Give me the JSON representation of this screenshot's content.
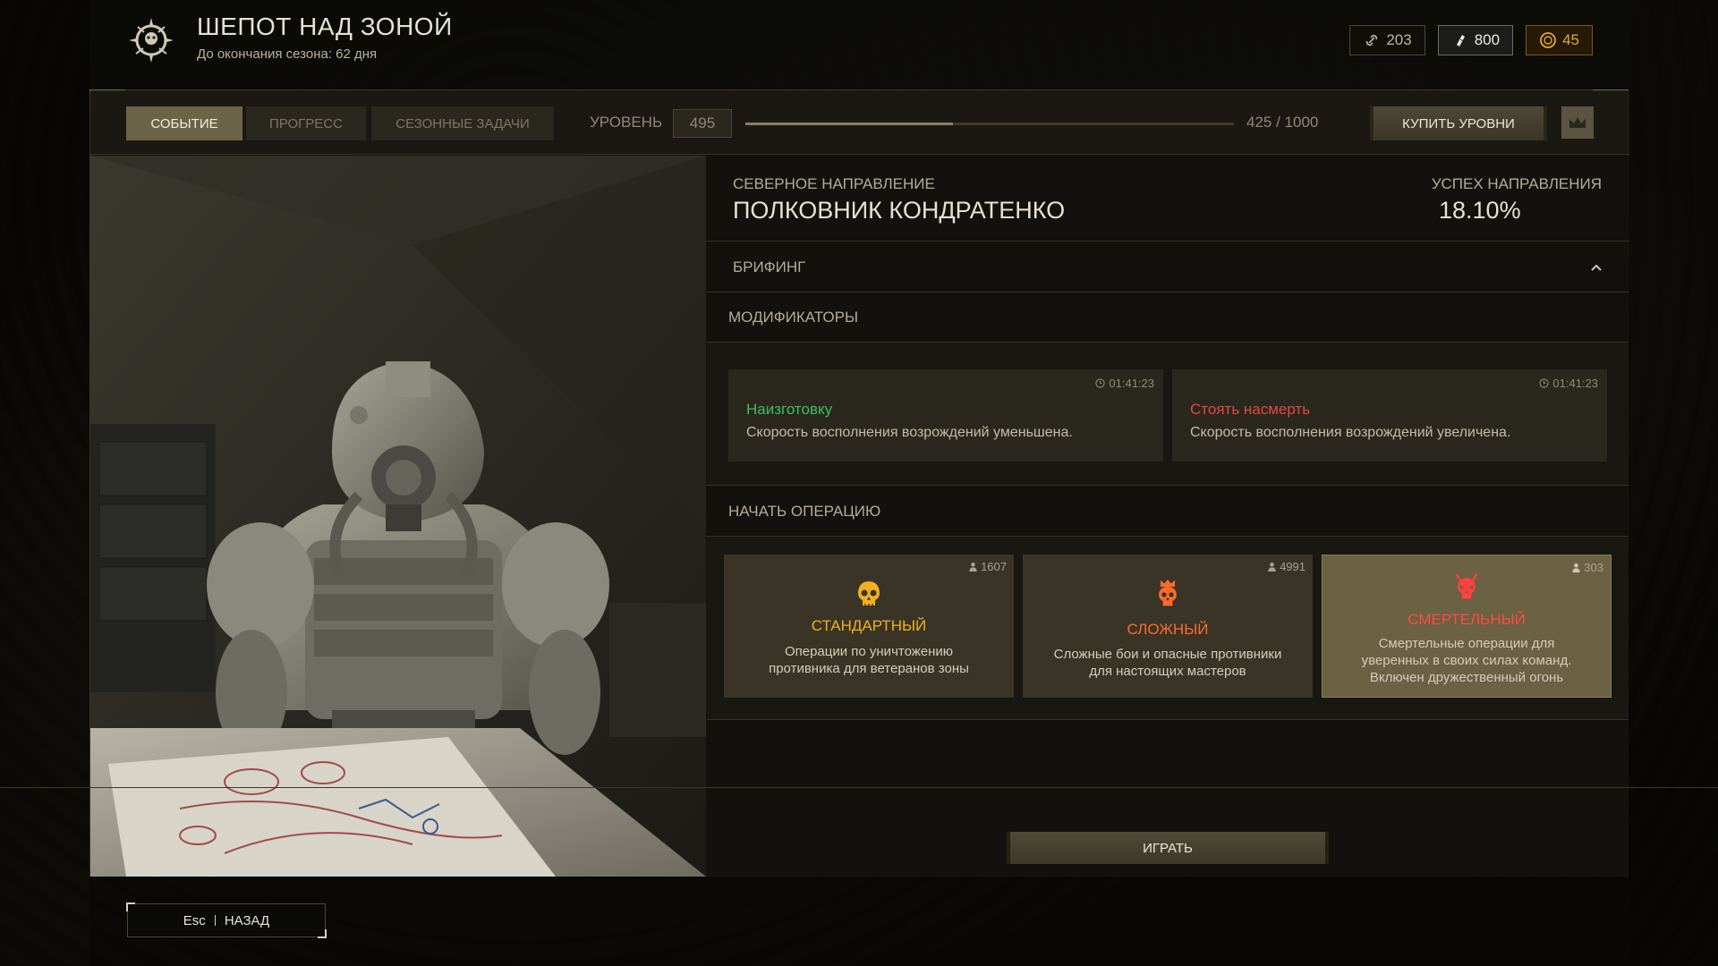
{
  "header": {
    "title": "ШЕПОТ НАД ЗОНОЙ",
    "subtitle": "До окончания сезона: 62 дня",
    "currencies": [
      {
        "icon": "link-icon",
        "value": "203"
      },
      {
        "icon": "ticket-icon",
        "value": "800"
      },
      {
        "icon": "coin-icon",
        "value": "45"
      }
    ]
  },
  "tabs": [
    {
      "label": "СОБЫТИЕ",
      "active": true
    },
    {
      "label": "ПРОГРЕСС",
      "active": false
    },
    {
      "label": "СЕЗОННЫЕ ЗАДАЧИ",
      "active": false
    }
  ],
  "level": {
    "label": "УРОВЕНЬ",
    "value": "495",
    "progress_text": "425 / 1000",
    "progress_fraction": 0.425,
    "buy_label": "КУПИТЬ УРОВНИ"
  },
  "direction": {
    "label": "СЕВЕРНОЕ НАПРАВЛЕНИЕ",
    "name": "ПОЛКОВНИК КОНДРАТЕНКО",
    "success_label": "УСПЕХ НАПРАВЛЕНИЯ",
    "success_value": "18.10%"
  },
  "sections": {
    "briefing": "БРИФИНГ",
    "modifiers": "МОДИФИКАТОРЫ",
    "start_operation": "НАЧАТЬ ОПЕРАЦИЮ"
  },
  "modifiers": [
    {
      "title": "Наизготовку",
      "desc": "Скорость восполнения возрождений уменьшена.",
      "timer": "01:41:23",
      "color": "#3fbf5a"
    },
    {
      "title": "Стоять насмерть",
      "desc": "Скорость восполнения возрождений увеличена.",
      "timer": "01:41:23",
      "color": "#e2483f"
    }
  ],
  "operations": [
    {
      "title": "СТАНДАРТНЫЙ",
      "desc_lines": [
        "Операции по уничтожению",
        "противника для ветеранов зоны"
      ],
      "players": "1607",
      "color": "#f0b020",
      "icon": "skull-icon"
    },
    {
      "title": "СЛОЖНЫЙ",
      "desc_lines": [
        "Сложные бои и опасные противники",
        "для настоящих мастеров"
      ],
      "players": "4991",
      "color": "#ff6a2a",
      "icon": "crowned-skull-icon"
    },
    {
      "title": "СМЕРТЕЛЬНЫЙ",
      "desc_lines": [
        "Смертельные операции для",
        "уверенных в своих силах команд.",
        "Включен дружественный огонь"
      ],
      "players": "303",
      "color": "#ff4040",
      "icon": "demon-skull-icon"
    }
  ],
  "play_label": "ИГРАТЬ",
  "footer": {
    "key": "Esc",
    "back_label": "НАЗАД"
  }
}
